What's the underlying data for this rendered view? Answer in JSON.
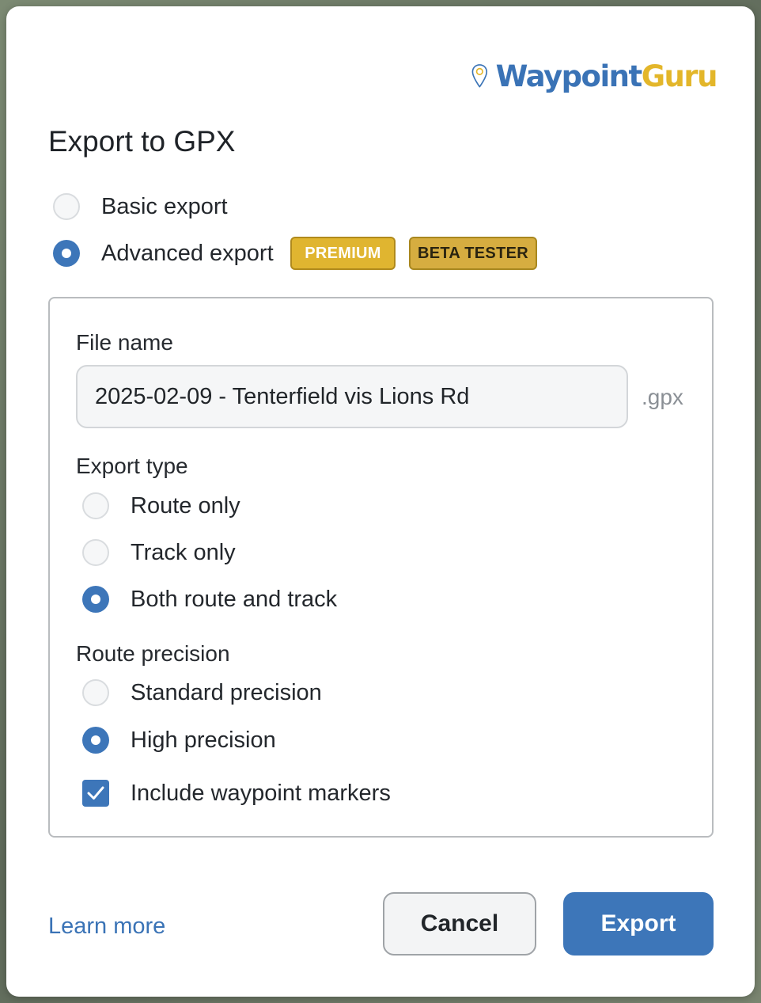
{
  "brand": {
    "name_part1": "Waypoint",
    "name_part2": "Guru",
    "primary_color": "#3a73b6",
    "accent_color": "#e3b62a"
  },
  "dialog": {
    "title": "Export to GPX"
  },
  "export_mode": {
    "options": [
      {
        "label": "Basic export",
        "checked": false
      },
      {
        "label": "Advanced export",
        "checked": true
      }
    ],
    "badges": [
      "PREMIUM",
      "BETA TESTER"
    ]
  },
  "file_name": {
    "label": "File name",
    "value": "2025-02-09 - Tenterfield vis Lions Rd",
    "extension": ".gpx"
  },
  "export_type": {
    "label": "Export type",
    "options": [
      {
        "label": "Route only",
        "checked": false
      },
      {
        "label": "Track only",
        "checked": false
      },
      {
        "label": "Both route and track",
        "checked": true
      }
    ]
  },
  "route_precision": {
    "label": "Route precision",
    "options": [
      {
        "label": "Standard precision",
        "checked": false
      },
      {
        "label": "High precision",
        "checked": true
      }
    ]
  },
  "waypoint_markers": {
    "label": "Include waypoint markers",
    "checked": true
  },
  "footer": {
    "learn_more": "Learn more",
    "cancel": "Cancel",
    "export": "Export"
  }
}
